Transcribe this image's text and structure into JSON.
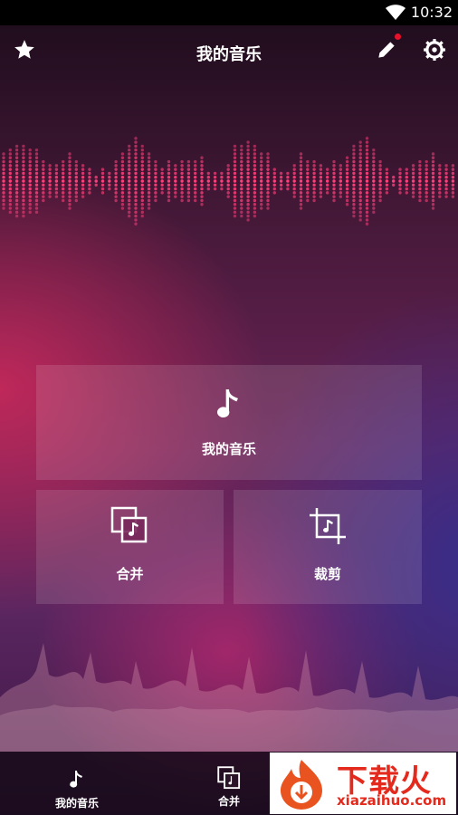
{
  "status_bar": {
    "time": "10:32"
  },
  "header": {
    "title": "我的音乐"
  },
  "cards": {
    "my_music": "我的音乐",
    "merge": "合并",
    "trim": "裁剪"
  },
  "bottom_nav": {
    "my_music": "我的音乐",
    "merge": "合并"
  },
  "ad": {
    "brand": "下载火",
    "url": "xiazaihuo.com"
  },
  "icons": [
    "star-icon",
    "edit-icon",
    "settings-icon",
    "music-note-icon",
    "merge-icon",
    "crop-icon",
    "wifi-icon"
  ],
  "colors": {
    "accent_red": "#e8102a",
    "equalizer_pink": "#ff3f7a",
    "ad_red": "#e32a1c"
  }
}
